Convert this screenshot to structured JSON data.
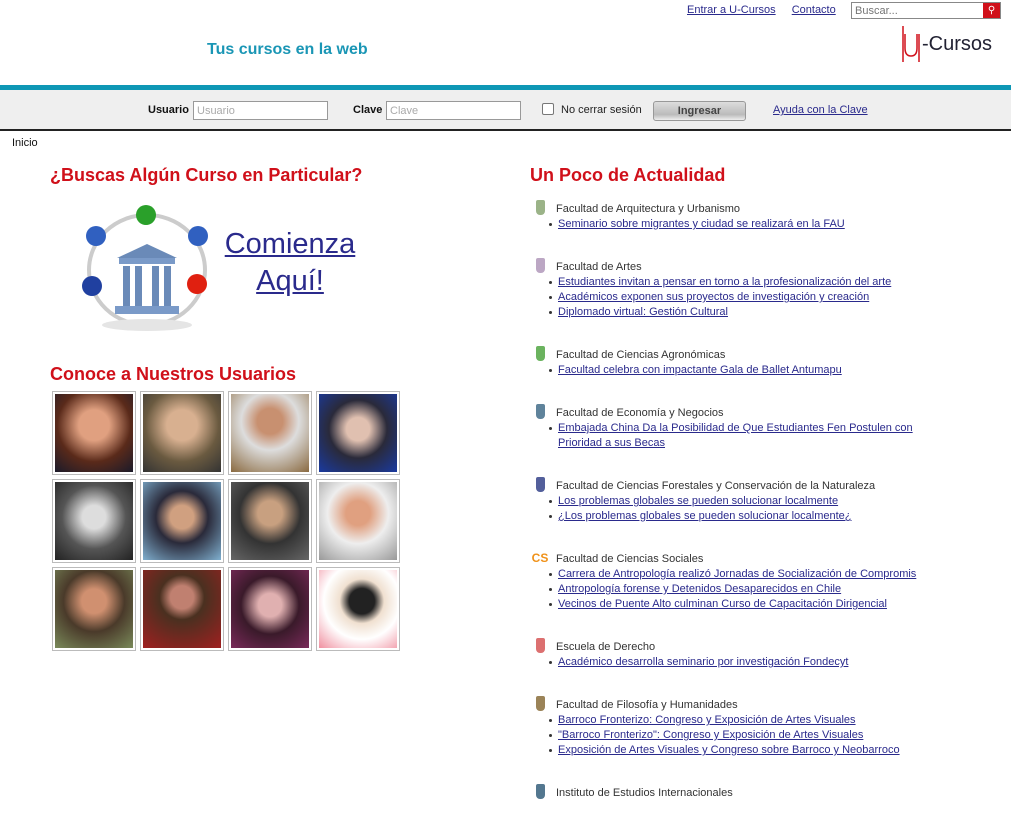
{
  "header": {
    "links": [
      "Entrar a U-Cursos",
      "Contacto"
    ],
    "search_placeholder": "Buscar...",
    "tagline": "Tus cursos en la web",
    "logo_text": "-Cursos"
  },
  "login": {
    "user_label": "Usuario",
    "user_placeholder": "Usuario",
    "pass_label": "Clave",
    "pass_placeholder": "Clave",
    "remember_label": "No cerrar sesión",
    "remember_checked": false,
    "submit": "Ingresar",
    "help": "Ayuda con la Clave"
  },
  "breadcrumb": "Inicio",
  "left": {
    "search_title": "¿Buscas Algún Curso en Particular?",
    "cta_line1": "Comienza",
    "cta_line2": "Aquí!",
    "users_title": "Conoce a Nuestros Usuarios"
  },
  "right": {
    "title": "Un Poco de Actualidad",
    "faculties": [
      {
        "name": "Facultad de Arquitectura y Urbanismo",
        "icon": "crest-icon",
        "color": "#7a9a60",
        "items": [
          "Seminario sobre migrantes y ciudad se realizará en la FAU"
        ]
      },
      {
        "name": "Facultad de Artes",
        "icon": "crest-icon",
        "color": "#a58ab0",
        "items": [
          "Estudiantes invitan a pensar en torno a la profesionalización del arte",
          "Académicos exponen sus proyectos de investigación y creación",
          "Diplomado virtual: Gestión Cultural"
        ]
      },
      {
        "name": "Facultad de Ciencias Agronómicas",
        "icon": "u-leaf-icon",
        "color": "#3a9a2a",
        "items": [
          "Facultad celebra con impactante Gala de Ballet Antumapu"
        ]
      },
      {
        "name": "Facultad de Economía y Negocios",
        "icon": "crest-icon",
        "color": "#2a5a7a",
        "items": [
          "Embajada China Da la Posibilidad de Que Estudiantes Fen Postulen con Prioridad a sus Becas"
        ]
      },
      {
        "name": "Facultad de Ciencias Forestales y Conservación de la Naturaleza",
        "icon": "u-tree-icon",
        "color": "#1a2a7a",
        "items": [
          "Los problemas globales se pueden solucionar localmente",
          "¿Los problemas globales se pueden solucionar localmente¿"
        ]
      },
      {
        "name": "Facultad de Ciencias Sociales",
        "icon": "cs-icon",
        "icon_text": "CS",
        "color": "#f0921a",
        "items": [
          "Carrera de Antropología realizó Jornadas de Socialización de Compromis",
          "Antropología forense y Detenidos Desaparecidos en Chile",
          "Vecinos de Puente Alto culminan Curso de Capacitación Dirigencial"
        ]
      },
      {
        "name": "Escuela de Derecho",
        "icon": "crest-icon",
        "color": "#d04040",
        "items": [
          "Académico desarrolla seminario por investigación Fondecyt"
        ]
      },
      {
        "name": "Facultad de Filosofía y Humanidades",
        "icon": "crest-icon",
        "color": "#7a5a20",
        "items": [
          "Barroco Fronterizo: Congreso y Exposición de Artes Visuales",
          "\"Barroco Fronterizo\": Congreso y Exposición de Artes Visuales",
          "Exposición de Artes Visuales y Congreso sobre Barroco y Neobarroco"
        ]
      },
      {
        "name": "Instituto de Estudios Internacionales",
        "icon": "globe-icon",
        "color": "#1a4a6a",
        "items": []
      }
    ]
  },
  "colors": {
    "accent": "#0e97b5",
    "title_red": "#d0101a",
    "link": "#2a2a8c"
  }
}
